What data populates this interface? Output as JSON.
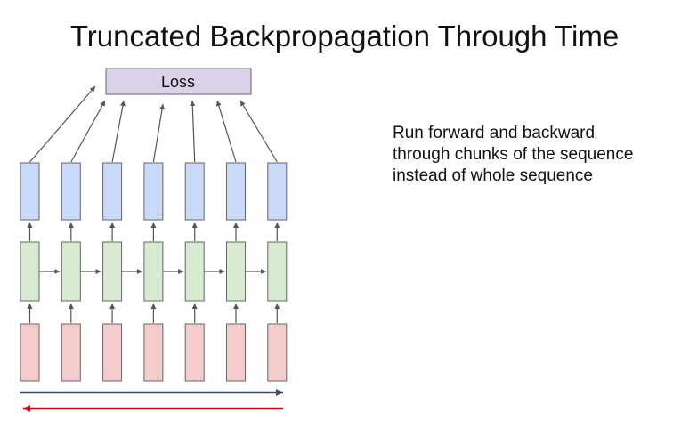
{
  "title": "Truncated Backpropagation Through Time",
  "loss_label": "Loss",
  "caption_lines": [
    "Run forward and backward",
    "through chunks of the sequence",
    "instead of whole sequence"
  ],
  "timesteps": 7,
  "colors": {
    "loss_fill": "#d9d2e9",
    "output_fill": "#c9daf8",
    "hidden_fill": "#d9ead3",
    "input_fill": "#f4cccc",
    "box_stroke": "#666666",
    "arrow": "#555555",
    "forward_arrow": "#3c4d63",
    "backward_arrow": "#e0000d"
  }
}
